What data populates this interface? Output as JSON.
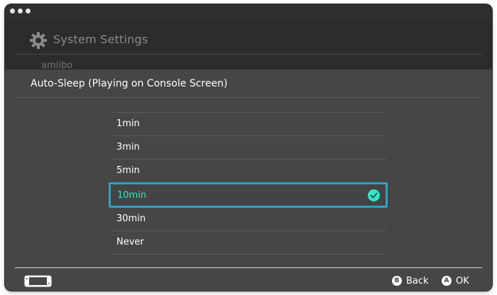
{
  "background": {
    "title": "System Settings",
    "visible_item": "amiibo"
  },
  "dialog": {
    "title": "Auto-Sleep (Playing on Console Screen)",
    "options": [
      {
        "label": "1min",
        "selected": false
      },
      {
        "label": "3min",
        "selected": false
      },
      {
        "label": "5min",
        "selected": false
      },
      {
        "label": "10min",
        "selected": true
      },
      {
        "label": "30min",
        "selected": false
      },
      {
        "label": "Never",
        "selected": false
      }
    ]
  },
  "footer": {
    "back": {
      "button": "B",
      "label": "Back"
    },
    "ok": {
      "button": "A",
      "label": "OK"
    }
  },
  "colors": {
    "selected_text": "#2ee8c6",
    "selected_border": "#2aa4c9",
    "panel": "#464646"
  }
}
